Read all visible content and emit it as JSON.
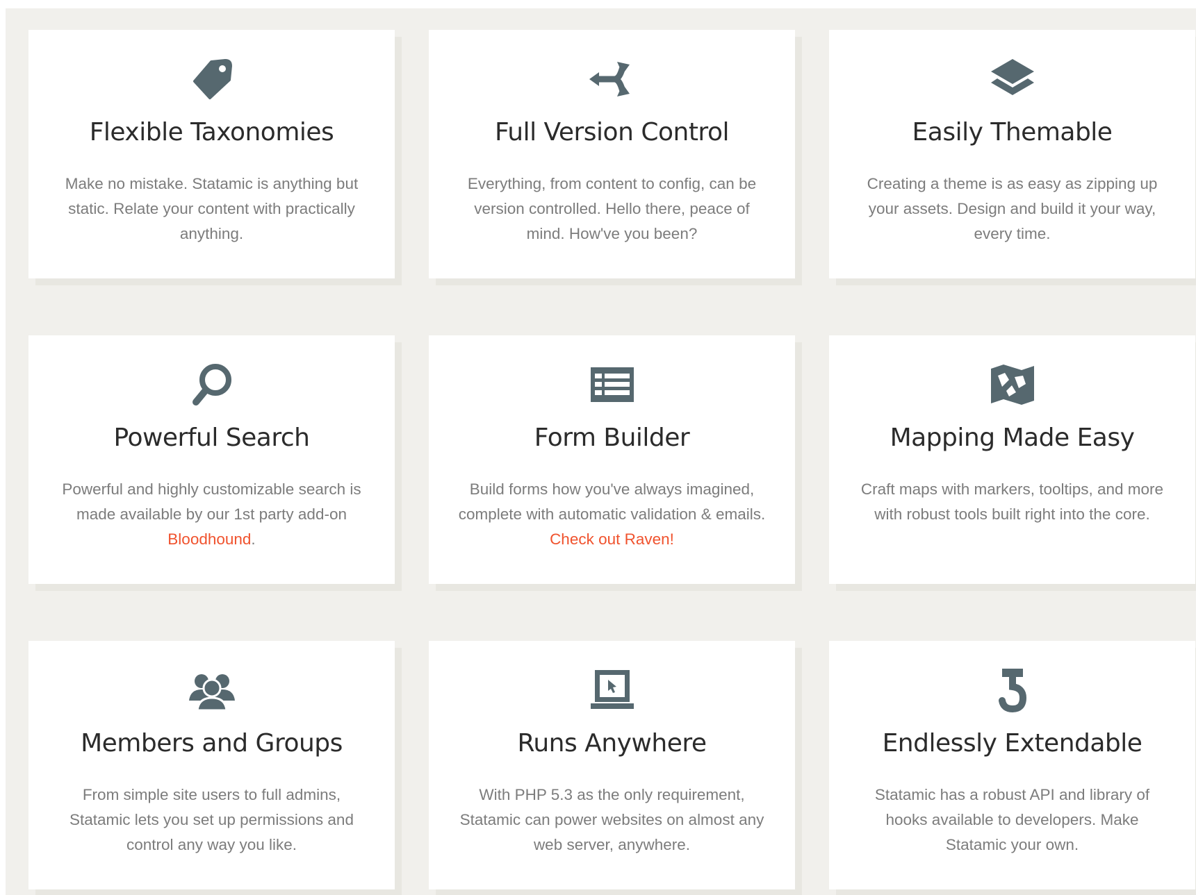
{
  "colors": {
    "background": "#f1f0ec",
    "card": "#ffffff",
    "icon": "#56686f",
    "title": "#2b2b2b",
    "text": "#7c7c7c",
    "link": "#f0522d"
  },
  "features": [
    {
      "icon": "tag-icon",
      "title": "Flexible Taxonomies",
      "description": "Make no mistake. Statamic is anything but static. Relate your content with practically anything."
    },
    {
      "icon": "fork-arrows-icon",
      "title": "Full Version Control",
      "description": "Everything, from content to config, can be version controlled. Hello there, peace of mind. How've you been?"
    },
    {
      "icon": "layers-icon",
      "title": "Easily Themable",
      "description": "Creating a theme is as easy as zipping up your assets. Design and build it your way, every time."
    },
    {
      "icon": "search-icon",
      "title": "Powerful Search",
      "description": "Powerful and highly customizable search is made available by our 1st party add-on ",
      "link_text": "Bloodhound",
      "after_link": "."
    },
    {
      "icon": "form-table-icon",
      "title": "Form Builder",
      "description": "Build forms how you've always imagined, complete with automatic validation & emails. ",
      "link_text": "Check out Raven!"
    },
    {
      "icon": "map-icon",
      "title": "Mapping Made Easy",
      "description": "Craft maps with markers, tooltips, and more with robust tools built right into the core."
    },
    {
      "icon": "users-icon",
      "title": "Members and Groups",
      "description": "From simple site users to full admins, Statamic lets you set up permissions and control any way you like."
    },
    {
      "icon": "laptop-icon",
      "title": "Runs Anywhere",
      "description": "With PHP 5.3 as the only requirement, Statamic can power websites on almost any web server, anywhere."
    },
    {
      "icon": "hook-icon",
      "title": "Endlessly Extendable",
      "description": "Statamic has a robust API and library of hooks available to developers. Make Statamic your own."
    }
  ]
}
